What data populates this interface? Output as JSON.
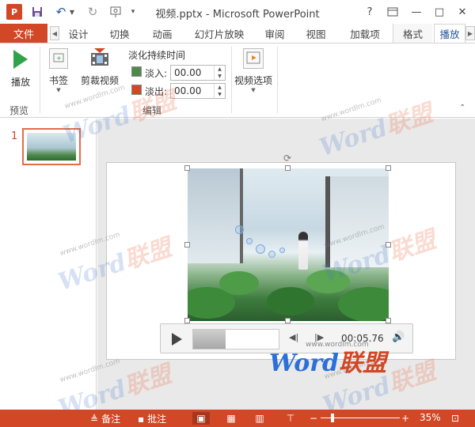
{
  "titlebar": {
    "app_logo": "P",
    "title": "视频.pptx - Microsoft PowerPoint",
    "help": "?",
    "minimize": "—",
    "restore": "□",
    "close": "✕"
  },
  "tabs": {
    "file": "文件",
    "items": [
      "设计",
      "切换",
      "动画",
      "幻灯片放映",
      "审阅",
      "视图",
      "加载项",
      "格式",
      "播放"
    ],
    "active": "播放"
  },
  "ribbon": {
    "preview_group": {
      "play_label": "播放",
      "group_label": "预览"
    },
    "bookmark_label": "书签",
    "trim_label": "剪裁视频",
    "fade": {
      "title": "淡化持续时间",
      "fade_in_label": "淡入:",
      "fade_in_value": "00.00",
      "fade_out_label": "淡出:",
      "fade_out_value": "00.00"
    },
    "video_options_label": "视频选项",
    "edit_group_label": "编辑"
  },
  "slides": {
    "number": "1"
  },
  "media": {
    "time": "00:05.76",
    "progress": 0.38
  },
  "watermark": {
    "brand_word": "Word",
    "brand_cn": "联盟",
    "url": "www.wordlm.com"
  },
  "statusbar": {
    "notes": "备注",
    "comments": "批注",
    "zoom": "35%"
  },
  "colors": {
    "accent": "#d24726",
    "active_tab_text": "#2b579a",
    "play_green": "#31a24c"
  }
}
